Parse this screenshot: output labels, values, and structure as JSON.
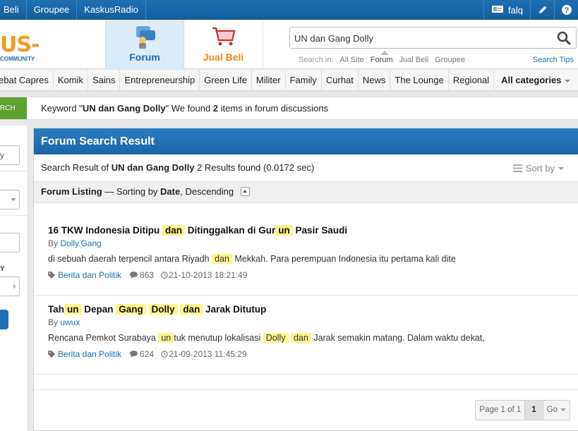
{
  "topbar": {
    "nav": [
      "Beli",
      "Groupee",
      "KaskusRadio"
    ],
    "username": "falq"
  },
  "header": {
    "logo_text": "US-",
    "logo_sub": "COMMUNITY",
    "tabs": [
      {
        "label": "Forum",
        "icon": "forum-icon",
        "active": true
      },
      {
        "label": "Jual Beli",
        "icon": "shopping-cart-icon",
        "active": false
      }
    ],
    "search": {
      "value": "UN dan Gang Dolly",
      "search_in_label": "Search in:",
      "options": [
        "All Site",
        "Forum",
        "Jual Beli",
        "Groupee"
      ],
      "active_option": "Forum",
      "tips": "Search Tips"
    }
  },
  "categories": {
    "items": [
      "ebat Capres",
      "Komik",
      "Sains",
      "Entrepreneurship",
      "Green Life",
      "Militer",
      "Family",
      "Curhat",
      "News",
      "The Lounge",
      "Regional"
    ],
    "all_label": "All categories"
  },
  "keyword_bar": {
    "tag": "RCH",
    "prefix": "Keyword \"",
    "keyword": "UN dan Gang Dolly",
    "middle": "\" We found ",
    "count": "2",
    "suffix": " items in forum discussions"
  },
  "sidebar": {
    "field1_value": "y",
    "label_y": "Y"
  },
  "main": {
    "title": "Forum Search Result",
    "summary_prefix": "Search Result of ",
    "summary_query": "UN dan Gang Dolly",
    "summary_suffix": " 2 Results found (0.0172 sec)",
    "sort_label": "Sort by",
    "listing_label": "Forum Listing",
    "listing_dash": " — Sorting by ",
    "listing_sort": "Date",
    "listing_comma": ", ",
    "listing_order": "Descending"
  },
  "results": [
    {
      "title_parts": [
        "16 TKW Indonesia Ditipu ",
        "dan",
        " Ditinggalkan di Gur",
        "un",
        " Pasir Saudi"
      ],
      "by_label": "By ",
      "author": "Dolly.Gang",
      "snippet_parts": [
        "di sebuah daerah terpencil antara Riyadh ",
        "dan",
        " Mekkah. Para perempuan Indonesia itu pertama kali dite"
      ],
      "category": "Berita dan Politik",
      "comments": "863",
      "date": "21-10-2013 18:21:49"
    },
    {
      "title_parts": [
        "Tah",
        "un",
        " Depan ",
        "Gang",
        " ",
        "Dolly",
        " ",
        "dan",
        " Jarak Ditutup"
      ],
      "by_label": "By ",
      "author": "uwux",
      "snippet_parts": [
        "Rencana Pemkot Surabaya ",
        "un",
        "tuk menutup lokalisasi ",
        "Dolly",
        " ",
        "dan",
        " Jarak semakin matang. Dalam waktu dekat,"
      ],
      "category": "Berita dan Politik",
      "comments": "624",
      "date": "21-09-2013 11:45:29"
    }
  ],
  "pager": {
    "page_label": "Page 1 of 1",
    "current": "1",
    "go": "Go"
  },
  "colors": {
    "brand_blue": "#1e6fb3",
    "accent_orange": "#f39a1e",
    "highlight": "#fff48a",
    "green_tag": "#5da22f"
  }
}
